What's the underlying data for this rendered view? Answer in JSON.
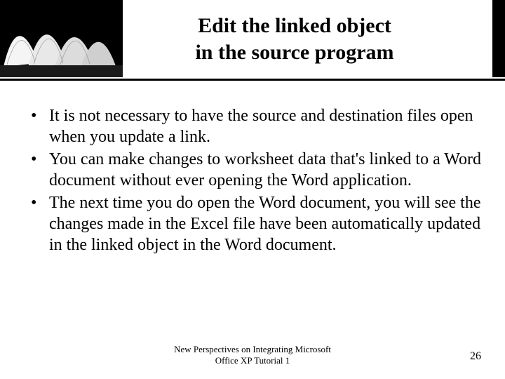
{
  "title": {
    "line1": "Edit the linked object",
    "line2": "in the source program"
  },
  "bullets": [
    "It is not necessary to have the source and destination files open when you update a link.",
    "You can make changes to worksheet data that's linked to a Word document without ever opening the Word application.",
    "The next time you do open the Word document, you will see the changes made in the Excel file have been automatically updated in the linked object in the Word document."
  ],
  "footer": {
    "line1": "New Perspectives on Integrating Microsoft",
    "line2": "Office XP Tutorial 1",
    "page": "26"
  }
}
